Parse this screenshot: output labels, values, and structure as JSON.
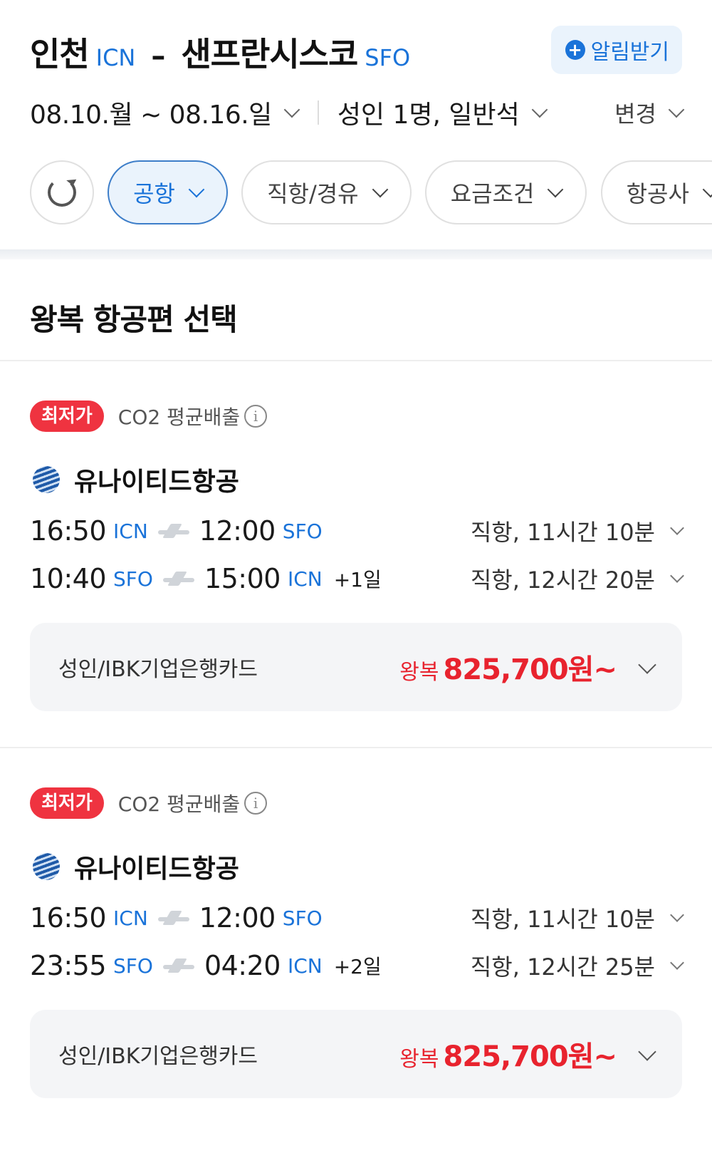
{
  "header": {
    "origin_city": "인천",
    "origin_code": "ICN",
    "separator": "–",
    "dest_city": "샌프란시스코",
    "dest_code": "SFO",
    "alert_label": "알림받기",
    "dates": "08.10.월 ~ 08.16.일",
    "passengers": "성인 1명, 일반석",
    "change_label": "변경"
  },
  "filters": [
    {
      "label": "공항"
    },
    {
      "label": "직항/경유"
    },
    {
      "label": "요금조건"
    },
    {
      "label": "항공사"
    }
  ],
  "section_title": "왕복 항공편 선택",
  "results": [
    {
      "badge": "최저가",
      "co2": "CO2 평균배출",
      "airline": "유나이티드항공",
      "outbound": {
        "dep_time": "16:50",
        "dep_code": "ICN",
        "arr_time": "12:00",
        "arr_code": "SFO",
        "day_offset": "",
        "duration": "직항, 11시간 10분"
      },
      "inbound": {
        "dep_time": "10:40",
        "dep_code": "SFO",
        "arr_time": "15:00",
        "arr_code": "ICN",
        "day_offset": "+1일",
        "duration": "직항, 12시간 20분"
      },
      "fare_label": "성인/IBK기업은행카드",
      "price_prefix": "왕복",
      "price": "825,700원~"
    },
    {
      "badge": "최저가",
      "co2": "CO2 평균배출",
      "airline": "유나이티드항공",
      "outbound": {
        "dep_time": "16:50",
        "dep_code": "ICN",
        "arr_time": "12:00",
        "arr_code": "SFO",
        "day_offset": "",
        "duration": "직항, 11시간 10분"
      },
      "inbound": {
        "dep_time": "23:55",
        "dep_code": "SFO",
        "arr_time": "04:20",
        "arr_code": "ICN",
        "day_offset": "+2일",
        "duration": "직항, 12시간 25분"
      },
      "fare_label": "성인/IBK기업은행카드",
      "price_prefix": "왕복",
      "price": "825,700원~"
    }
  ],
  "colors": {
    "accent": "#1a73d9",
    "price": "#e8232e",
    "badge": "#ef3340"
  }
}
